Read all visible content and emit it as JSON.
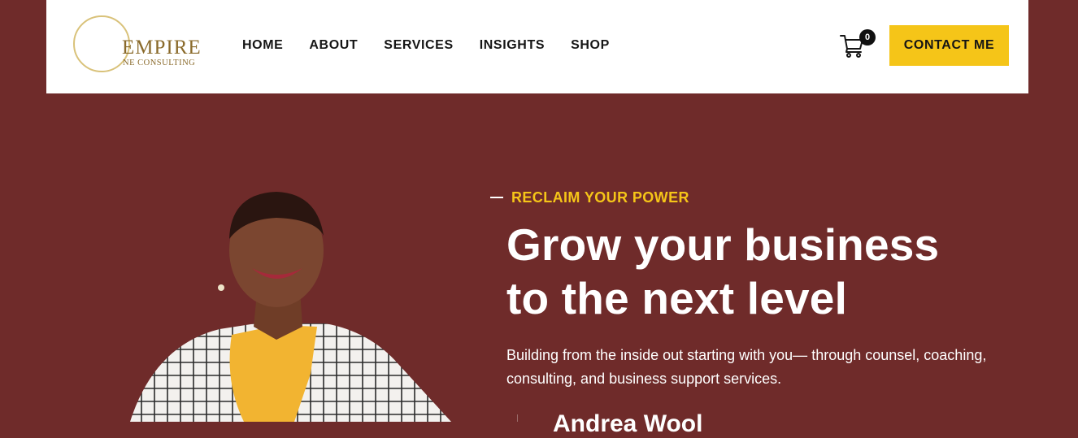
{
  "header": {
    "logo": {
      "word": "EMPIRE",
      "tagline": "NE CONSULTING"
    },
    "nav": [
      {
        "label": "HOME"
      },
      {
        "label": "ABOUT"
      },
      {
        "label": "SERVICES"
      },
      {
        "label": "INSIGHTS"
      },
      {
        "label": "SHOP"
      }
    ],
    "cart_count": "0",
    "contact_label": "CONTACT ME"
  },
  "hero": {
    "eyebrow": "RECLAIM YOUR POWER",
    "headline_line1": "Grow your business",
    "headline_line2": "to the next level",
    "subtext": "Building from the inside out starting with you— through counsel, coaching, consulting, and business support services.",
    "cutoff_text": "Andrea Wool"
  },
  "colors": {
    "background": "#6f2b2a",
    "accent": "#f5c518",
    "header_bg": "#ffffff",
    "logo_gold": "#8a6a2b"
  },
  "icons": [
    "cart-icon",
    "logo-ring-icon"
  ]
}
